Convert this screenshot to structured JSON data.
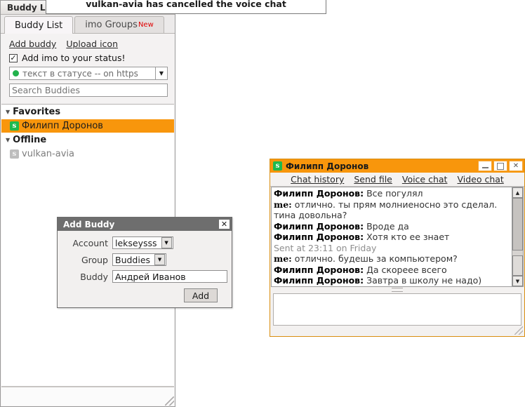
{
  "main_window": {
    "title": "Buddy L",
    "tabs": [
      {
        "label": "Buddy List",
        "badge": ""
      },
      {
        "label": "imo Groups",
        "badge": "New"
      }
    ],
    "links": [
      {
        "label": "Add buddy"
      },
      {
        "label": "Upload icon"
      }
    ],
    "checkbox": {
      "label": "Add imo to your status!",
      "checked_glyph": "✓"
    },
    "status": {
      "text": "текст в статусе -- on https",
      "dot_color": "#22b24c",
      "arrow": "▼"
    },
    "search": {
      "placeholder": "Search Buddies",
      "value": ""
    },
    "groups": [
      {
        "name": "Favorites",
        "collapse_arrow": "▼",
        "buddies": [
          {
            "name": "Филипп Доронов",
            "badge": "s",
            "selected": true,
            "offline": false
          }
        ]
      },
      {
        "name": "Offline",
        "collapse_arrow": "▼",
        "buddies": [
          {
            "name": "vulkan-avia",
            "badge": "s",
            "selected": false,
            "offline": true
          }
        ]
      }
    ]
  },
  "notification": {
    "text": "vulkan-avia has cancelled the voice chat"
  },
  "add_buddy_dialog": {
    "title": "Add Buddy",
    "close_glyph": "✕",
    "fields": {
      "account_label": "Account",
      "account_value": "lekseysss",
      "group_label": "Group",
      "group_value": "Buddies",
      "buddy_label": "Buddy",
      "buddy_value": "Андрей Иванов"
    },
    "arrow": "▼",
    "add_button": "Add"
  },
  "chat_window": {
    "title": "Филипп Доронов",
    "badge": "s",
    "window_buttons": {
      "minimize": "minimize-icon",
      "maximize": "maximize-icon",
      "close": "✕"
    },
    "toolbar": [
      {
        "label": "Chat history"
      },
      {
        "label": "Send file"
      },
      {
        "label": "Voice chat"
      },
      {
        "label": "Video chat"
      }
    ],
    "messages": [
      {
        "sender": "Филипп Доронов:",
        "text": " Все погулял",
        "type": "buddy"
      },
      {
        "sender": "me:",
        "text": " отлично. ты прям молниеносно это сделал. тина довольна?",
        "type": "me"
      },
      {
        "sender": "Филипп Доронов:",
        "text": " Вроде да",
        "type": "buddy"
      },
      {
        "sender": "Филипп Доронов:",
        "text": " Хотя кто ее знает",
        "type": "buddy"
      },
      {
        "sender": "",
        "text": "Sent at 23:11 on Friday",
        "type": "system"
      },
      {
        "sender": "me:",
        "text": " отлично. будешь за компьютером?",
        "type": "me"
      },
      {
        "sender": "Филипп Доронов:",
        "text": " Да скореее всего",
        "type": "buddy"
      },
      {
        "sender": "Филипп Доронов:",
        "text": " Завтра в школу не надо)",
        "type": "buddy"
      }
    ],
    "scrollbar": {
      "up_arrow": "▲",
      "down_arrow": "▼"
    },
    "input": {
      "value": "",
      "placeholder": ""
    }
  },
  "colors": {
    "accent_orange": "#f8960c",
    "online_green": "#1fb94e",
    "dialog_titlebar": "#6e6e6e",
    "new_badge_red": "#e00000"
  }
}
